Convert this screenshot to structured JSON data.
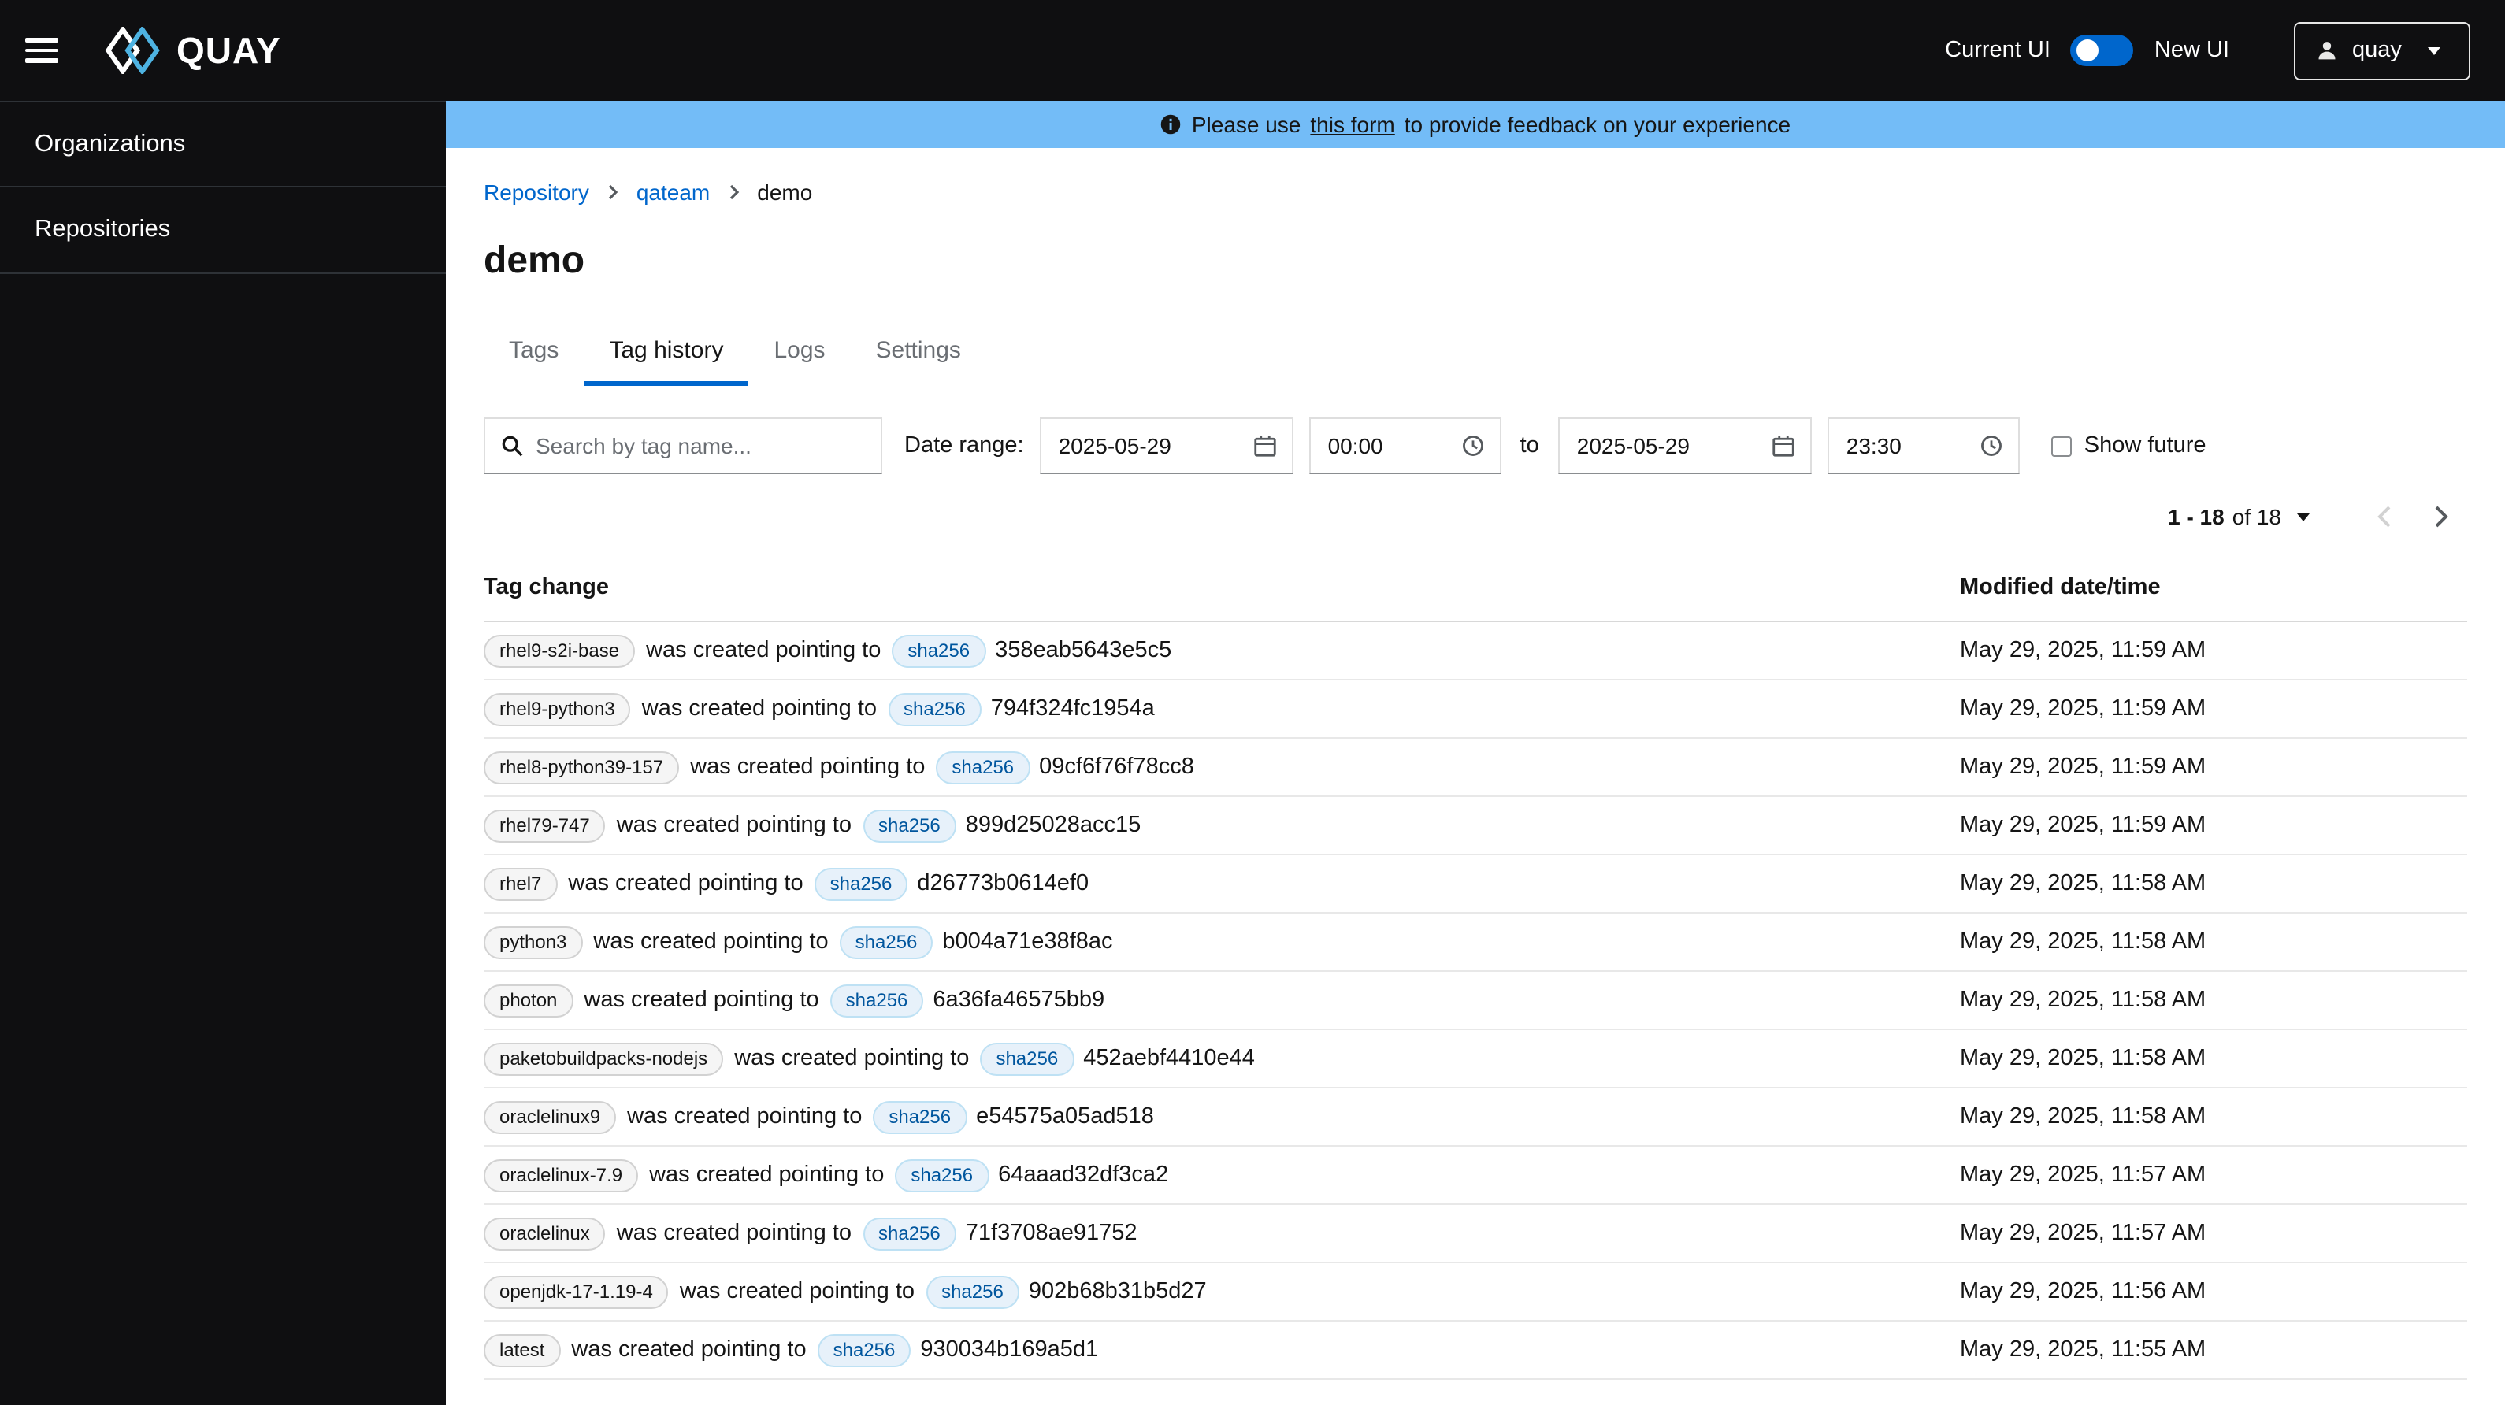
{
  "header": {
    "logo_text": "QUAY",
    "current_ui_label": "Current UI",
    "new_ui_label": "New UI",
    "user_menu": "quay"
  },
  "sidebar": {
    "items": [
      {
        "label": "Organizations"
      },
      {
        "label": "Repositories"
      }
    ]
  },
  "banner": {
    "prefix": "Please use",
    "link": "this form",
    "suffix": "to provide feedback on your experience"
  },
  "breadcrumb": {
    "items": [
      "Repository",
      "qateam",
      "demo"
    ]
  },
  "page": {
    "title": "demo"
  },
  "tabs": [
    {
      "label": "Tags"
    },
    {
      "label": "Tag history"
    },
    {
      "label": "Logs"
    },
    {
      "label": "Settings"
    }
  ],
  "toolbar": {
    "search_placeholder": "Search by tag name...",
    "date_range_label": "Date range:",
    "start_date": "2025-05-29",
    "start_time": "00:00",
    "to_label": "to",
    "end_date": "2025-05-29",
    "end_time": "23:30",
    "show_future_label": "Show future"
  },
  "pagination": {
    "range": "1 - 18",
    "of": "of 18"
  },
  "table": {
    "headers": [
      "Tag change",
      "Modified date/time"
    ],
    "rows": [
      {
        "tag": "rhel9-s2i-base",
        "action": "was created pointing to",
        "sha_label": "sha256",
        "digest": "358eab5643e5c5",
        "modified": "May 29, 2025, 11:59 AM"
      },
      {
        "tag": "rhel9-python3",
        "action": "was created pointing to",
        "sha_label": "sha256",
        "digest": "794f324fc1954a",
        "modified": "May 29, 2025, 11:59 AM"
      },
      {
        "tag": "rhel8-python39-157",
        "action": "was created pointing to",
        "sha_label": "sha256",
        "digest": "09cf6f76f78cc8",
        "modified": "May 29, 2025, 11:59 AM"
      },
      {
        "tag": "rhel79-747",
        "action": "was created pointing to",
        "sha_label": "sha256",
        "digest": "899d25028acc15",
        "modified": "May 29, 2025, 11:59 AM"
      },
      {
        "tag": "rhel7",
        "action": "was created pointing to",
        "sha_label": "sha256",
        "digest": "d26773b0614ef0",
        "modified": "May 29, 2025, 11:58 AM"
      },
      {
        "tag": "python3",
        "action": "was created pointing to",
        "sha_label": "sha256",
        "digest": "b004a71e38f8ac",
        "modified": "May 29, 2025, 11:58 AM"
      },
      {
        "tag": "photon",
        "action": "was created pointing to",
        "sha_label": "sha256",
        "digest": "6a36fa46575bb9",
        "modified": "May 29, 2025, 11:58 AM"
      },
      {
        "tag": "paketobuildpacks-nodejs",
        "action": "was created pointing to",
        "sha_label": "sha256",
        "digest": "452aebf4410e44",
        "modified": "May 29, 2025, 11:58 AM"
      },
      {
        "tag": "oraclelinux9",
        "action": "was created pointing to",
        "sha_label": "sha256",
        "digest": "e54575a05ad518",
        "modified": "May 29, 2025, 11:58 AM"
      },
      {
        "tag": "oraclelinux-7.9",
        "action": "was created pointing to",
        "sha_label": "sha256",
        "digest": "64aaad32df3ca2",
        "modified": "May 29, 2025, 11:57 AM"
      },
      {
        "tag": "oraclelinux",
        "action": "was created pointing to",
        "sha_label": "sha256",
        "digest": "71f3708ae91752",
        "modified": "May 29, 2025, 11:57 AM"
      },
      {
        "tag": "openjdk-17-1.19-4",
        "action": "was created pointing to",
        "sha_label": "sha256",
        "digest": "902b68b31b5d27",
        "modified": "May 29, 2025, 11:56 AM"
      },
      {
        "tag": "latest",
        "action": "was created pointing to",
        "sha_label": "sha256",
        "digest": "930034b169a5d1",
        "modified": "May 29, 2025, 11:55 AM"
      }
    ]
  },
  "colors": {
    "accent": "#0066cc",
    "header_bg": "#0f0f11",
    "banner_bg": "#73bcf7",
    "sha_pill_bg": "#e7f1fa",
    "tag_pill_bg": "#f5f5f5"
  }
}
